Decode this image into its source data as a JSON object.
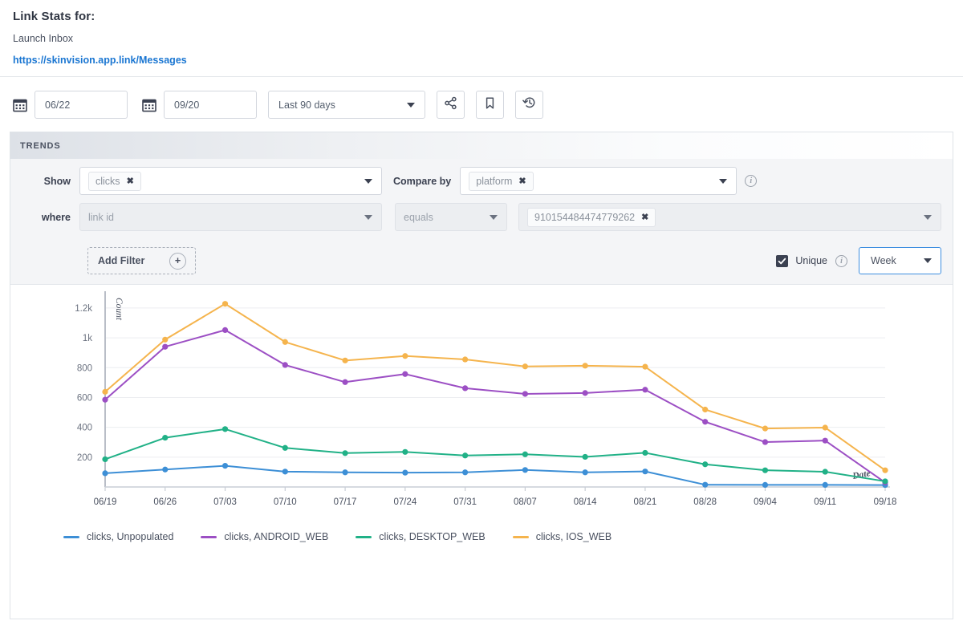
{
  "header": {
    "title": "Link Stats for:",
    "link_name": "Launch Inbox",
    "link_url": "https://skinvision.app.link/Messages"
  },
  "toolbar": {
    "start_date": "06/22",
    "end_date": "09/20",
    "range_label": "Last 90 days",
    "calendar_icon": "calendar-icon",
    "share_icon": "share-icon",
    "bookmark_icon": "bookmark-icon",
    "history_icon": "history-icon"
  },
  "panel": {
    "title": "TRENDS",
    "show_label": "Show",
    "show_chip": "clicks",
    "compare_label": "Compare by",
    "compare_chip": "platform",
    "where_label": "where",
    "where_field_placeholder": "link id",
    "operator": "equals",
    "value_chip": "910154484474779262",
    "add_filter_label": "Add Filter",
    "plus_icon": "plus-circle-icon",
    "info_icon": "info-icon",
    "unique_label": "Unique",
    "unique_checked": true,
    "granularity": "Week",
    "chip_remove_icon": "close-icon"
  },
  "chart_data": {
    "type": "line",
    "title": "",
    "xlabel": "Date",
    "ylabel": "Count",
    "ylim": [
      0,
      1280
    ],
    "yticks": [
      200,
      400,
      600,
      800,
      1000,
      1200
    ],
    "ytick_labels": [
      "200",
      "400",
      "600",
      "800",
      "1k",
      "1.2k"
    ],
    "grid": true,
    "legend_position": "bottom",
    "categories": [
      "06/19",
      "06/26",
      "07/03",
      "07/10",
      "07/17",
      "07/24",
      "07/31",
      "08/07",
      "08/14",
      "08/21",
      "08/28",
      "09/04",
      "09/11",
      "09/18"
    ],
    "series": [
      {
        "name": "clicks, Unpopulated",
        "color": "#3d8fd6",
        "values": [
          92,
          117,
          142,
          103,
          98,
          96,
          98,
          114,
          98,
          104,
          15,
          14,
          14,
          13
        ]
      },
      {
        "name": "clicks, ANDROID_WEB",
        "color": "#9c4fc4",
        "values": [
          585,
          940,
          1052,
          818,
          703,
          757,
          662,
          624,
          630,
          652,
          437,
          301,
          311,
          30
        ]
      },
      {
        "name": "clicks, DESKTOP_WEB",
        "color": "#21b187",
        "values": [
          186,
          330,
          388,
          262,
          227,
          235,
          211,
          219,
          202,
          229,
          152,
          112,
          102,
          38
        ]
      },
      {
        "name": "clicks, IOS_WEB",
        "color": "#f5b44d",
        "values": [
          638,
          988,
          1228,
          972,
          848,
          878,
          855,
          808,
          813,
          806,
          519,
          392,
          398,
          112
        ]
      }
    ]
  }
}
